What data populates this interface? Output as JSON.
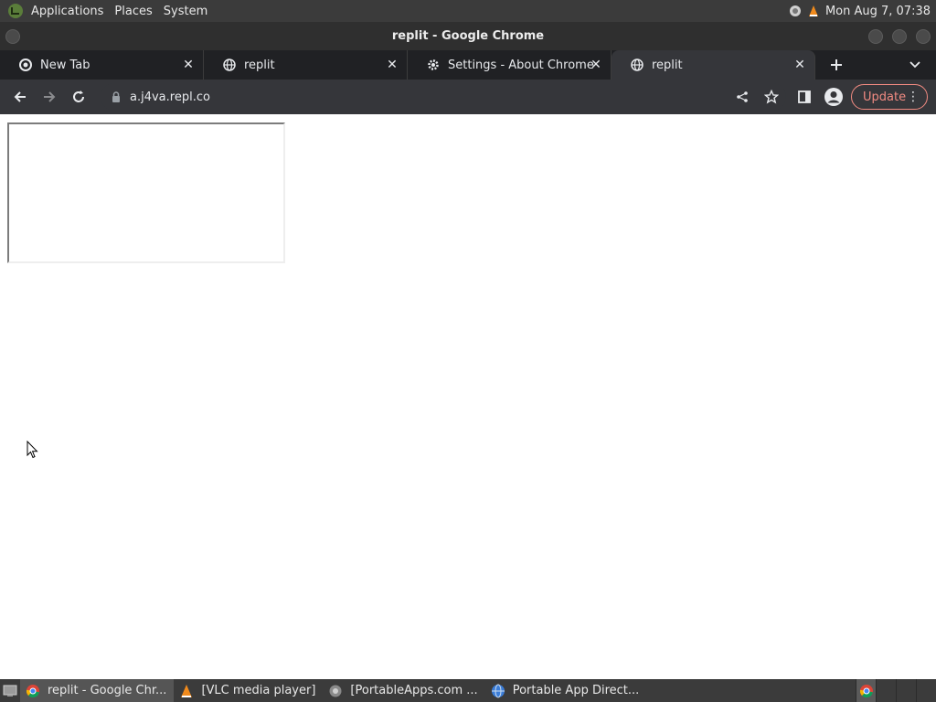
{
  "top_panel": {
    "menus": [
      "Applications",
      "Places",
      "System"
    ],
    "clock": "Mon Aug  7, 07:38",
    "logo_icon": "mint-logo-icon",
    "tray_icons": [
      "network-icon",
      "vlc-icon"
    ]
  },
  "window": {
    "title": "replit - Google Chrome"
  },
  "tabs": [
    {
      "label": "New Tab",
      "icon": "chrome-icon"
    },
    {
      "label": "replit",
      "icon": "globe-icon"
    },
    {
      "label": "Settings - About Chrome",
      "icon": "gear-icon"
    },
    {
      "label": "replit",
      "icon": "globe-icon",
      "active": true
    }
  ],
  "toolbar": {
    "url": "a.j4va.repl.co",
    "update_label": "Update"
  },
  "taskbar": {
    "tasks": [
      {
        "label": "replit - Google Chr...",
        "icon": "chrome-icon",
        "active": true
      },
      {
        "label": "[VLC media player]",
        "icon": "vlc-icon"
      },
      {
        "label": "[PortableApps.com ...",
        "icon": "portableapps-icon"
      },
      {
        "label": "Portable App Direct...",
        "icon": "globe-icon"
      }
    ]
  },
  "colors": {
    "panel_bg": "#3b3b3b",
    "tabstrip_bg": "#202124",
    "toolbar_bg": "#35363a",
    "update_accent": "#f28b82"
  }
}
